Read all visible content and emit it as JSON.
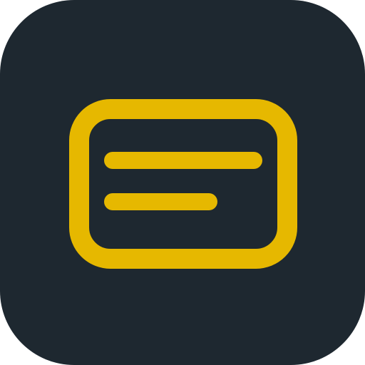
{
  "icon": {
    "name": "message-card-icon",
    "colors": {
      "background": "#1e2830",
      "accent": "#e6b800"
    }
  }
}
